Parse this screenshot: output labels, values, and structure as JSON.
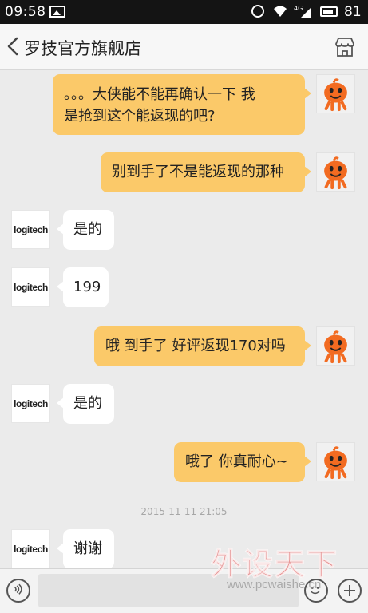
{
  "status_bar": {
    "time": "09:58",
    "network": "4G",
    "battery": "81"
  },
  "header": {
    "title": "罗技官方旗舰店"
  },
  "messages": [
    {
      "from": "me",
      "lines": [
        "。。。大侠能不能再确认一下 我",
        "是抢到这个能返现的吧?"
      ]
    },
    {
      "from": "me",
      "lines": [
        "别到手了不是能返现的那种"
      ]
    },
    {
      "from": "shop",
      "lines": [
        "是的"
      ]
    },
    {
      "from": "shop",
      "lines": [
        "199"
      ]
    },
    {
      "from": "me",
      "lines": [
        "哦 到手了 好评返现170对吗"
      ]
    },
    {
      "from": "shop",
      "lines": [
        "是的"
      ]
    },
    {
      "from": "me",
      "lines": [
        "哦了 你真耐心~"
      ]
    },
    {
      "from": "shop",
      "lines": [
        "谢谢"
      ]
    }
  ],
  "shop_avatar_text": "logitech",
  "timestamp": "2015-11-11 21:05",
  "watermark": {
    "big": "外设天下",
    "small": "www.pcwaishe.cn"
  },
  "colors": {
    "my_bubble": "#fbc969",
    "shop_bubble": "#ffffff",
    "background": "#ebebeb"
  }
}
